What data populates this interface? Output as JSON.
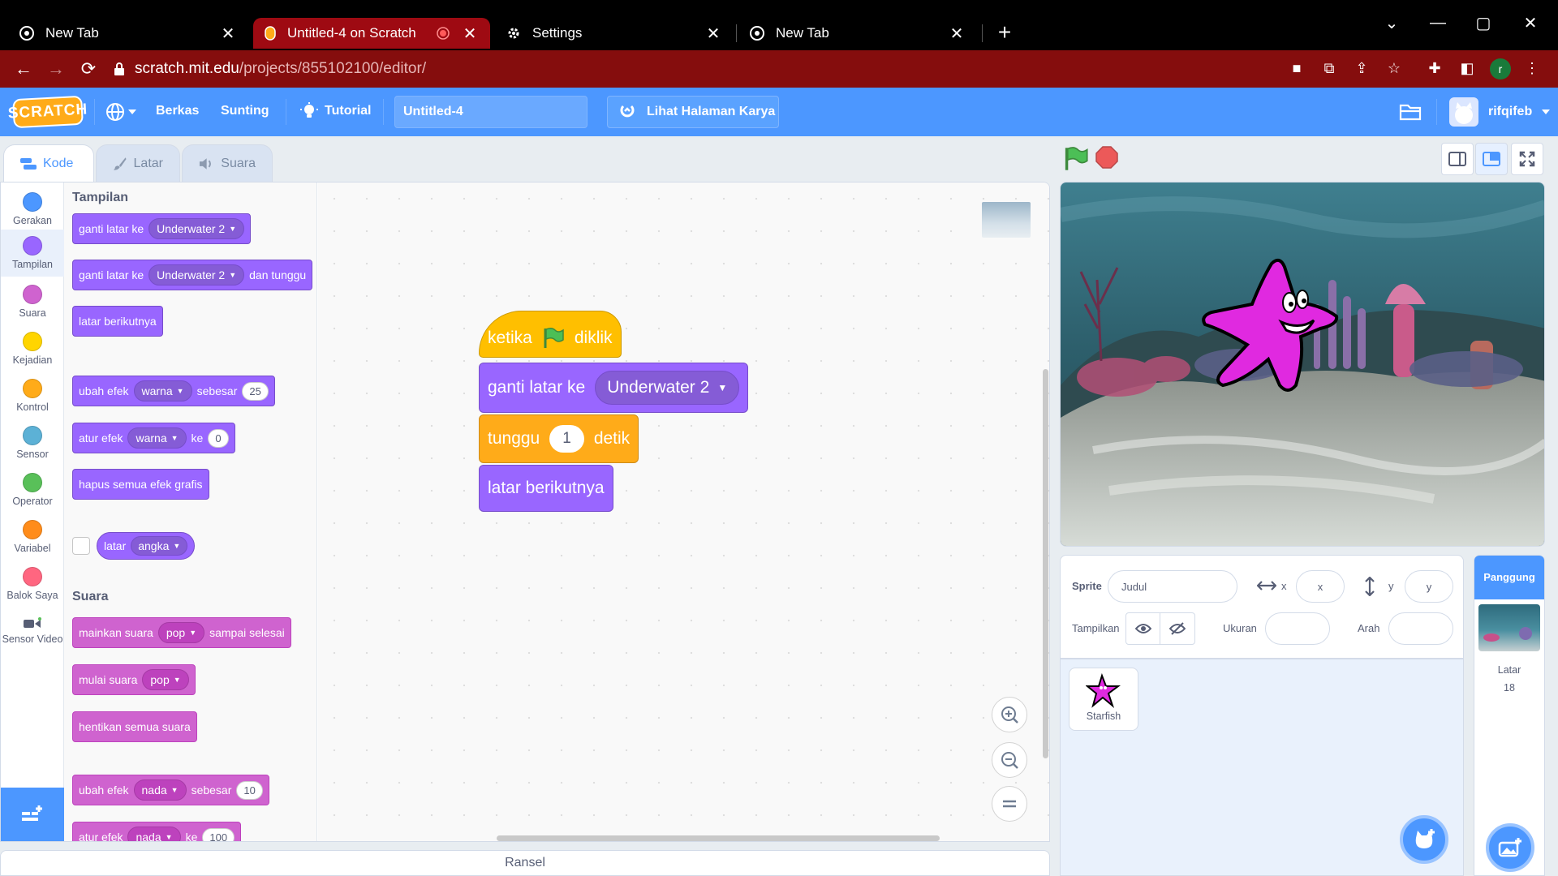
{
  "browser": {
    "tabs": [
      {
        "title": "New Tab",
        "icon": "chrome-icon"
      },
      {
        "title": "Untitled-4 on Scratch",
        "icon": "scratch-icon"
      },
      {
        "title": "Settings",
        "icon": "gear-icon"
      },
      {
        "title": "New Tab",
        "icon": "chrome-icon"
      }
    ],
    "url_host": "scratch.mit.edu",
    "url_path": "/projects/855102100/editor/",
    "profile_initial": "r"
  },
  "menu": {
    "file": "Berkas",
    "edit": "Sunting",
    "tutorial": "Tutorial",
    "project_title": "Untitled-4",
    "see_project": "Lihat Halaman Karya",
    "username": "rifqifeb"
  },
  "editor_tabs": {
    "code": "Kode",
    "backdrops": "Latar",
    "sounds": "Suara"
  },
  "categories": [
    {
      "label": "Gerakan",
      "color": "#4c97ff"
    },
    {
      "label": "Tampilan",
      "color": "#9966ff"
    },
    {
      "label": "Suara",
      "color": "#cf63cf"
    },
    {
      "label": "Kejadian",
      "color": "#ffd500"
    },
    {
      "label": "Kontrol",
      "color": "#ffab19"
    },
    {
      "label": "Sensor",
      "color": "#5cb1d6"
    },
    {
      "label": "Operator",
      "color": "#59c059"
    },
    {
      "label": "Variabel",
      "color": "#ff8c1a"
    },
    {
      "label": "Balok Saya",
      "color": "#ff6680"
    },
    {
      "label": "Sensor Video",
      "color": ""
    }
  ],
  "palette": {
    "looks_heading": "Tampilan",
    "b1": {
      "text": "ganti latar ke",
      "dd": "Underwater 2"
    },
    "b2": {
      "text": "ganti latar ke",
      "dd": "Underwater 2",
      "tail": "dan tunggu"
    },
    "b3": {
      "text": "latar berikutnya"
    },
    "b4": {
      "text": "ubah efek",
      "dd": "warna",
      "mid": "sebesar",
      "num": "25"
    },
    "b5": {
      "text": "atur efek",
      "dd": "warna",
      "mid": "ke",
      "num": "0"
    },
    "b6": {
      "text": "hapus semua efek grafis"
    },
    "b7": {
      "text": "latar",
      "dd": "angka"
    },
    "sound_heading": "Suara",
    "s1": {
      "text": "mainkan suara",
      "dd": "pop",
      "tail": "sampai selesai"
    },
    "s2": {
      "text": "mulai suara",
      "dd": "pop"
    },
    "s3": {
      "text": "hentikan semua suara"
    },
    "s4": {
      "text": "ubah efek",
      "dd": "nada",
      "mid": "sebesar",
      "num": "10"
    },
    "s5": {
      "text": "atur efek",
      "dd": "nada",
      "mid": "ke",
      "num": "100"
    }
  },
  "script": {
    "hat": {
      "pre": "ketika",
      "post": "diklik"
    },
    "b1": {
      "text": "ganti latar ke",
      "dd": "Underwater 2"
    },
    "b2": {
      "pre": "tunggu",
      "num": "1",
      "post": "detik"
    },
    "b3": {
      "text": "latar berikutnya"
    }
  },
  "backpack": "Ransel",
  "sprite_info": {
    "sprite_label": "Sprite",
    "name_placeholder": "Judul",
    "x_label": "x",
    "x_placeholder": "x",
    "y_label": "y",
    "y_placeholder": "y",
    "show_label": "Tampilkan",
    "size_label": "Ukuran",
    "direction_label": "Arah"
  },
  "sprites": [
    {
      "name": "Starfish"
    }
  ],
  "stage_pane": {
    "title": "Panggung",
    "backdrops_label": "Latar",
    "backdrop_count": "18"
  }
}
